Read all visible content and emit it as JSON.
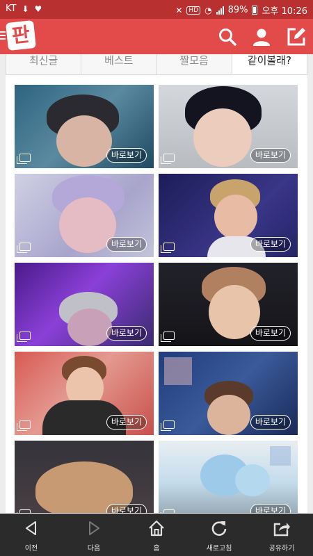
{
  "status": {
    "carrier": "KT",
    "battery": "89%",
    "time": "오후 10:26",
    "hd_label": "HD"
  },
  "header": {
    "logo_text": "판"
  },
  "tabs": [
    {
      "label": "최신글",
      "active": false
    },
    {
      "label": "베스트",
      "active": false
    },
    {
      "label": "짤모음",
      "active": false
    },
    {
      "label": "같이볼래?",
      "active": true
    }
  ],
  "cards": [
    {
      "button": "바로보기",
      "bg": "#3a6a8a"
    },
    {
      "button": "바로보기",
      "bg": "#c8ccd0"
    },
    {
      "button": "바로보기",
      "bg": "#a9a6c8"
    },
    {
      "button": "바로보기",
      "bg": "#2a2860"
    },
    {
      "button": "바로보기",
      "bg": "#6a2aa8"
    },
    {
      "button": "바로보기",
      "bg": "#1c1c28"
    },
    {
      "button": "바로보기",
      "bg": "#c8504a"
    },
    {
      "button": "바로보기",
      "bg": "#1e3c78"
    },
    {
      "button": "바로보기",
      "bg": "#3a3a40"
    },
    {
      "button": "바로보기",
      "bg": "#b8d8e8"
    }
  ],
  "bottom_nav": [
    {
      "label": "이전",
      "icon": "back-arrow-icon"
    },
    {
      "label": "다음",
      "icon": "forward-arrow-icon"
    },
    {
      "label": "홈",
      "icon": "home-icon"
    },
    {
      "label": "새로고침",
      "icon": "refresh-icon"
    },
    {
      "label": "공유하기",
      "icon": "share-icon"
    }
  ]
}
